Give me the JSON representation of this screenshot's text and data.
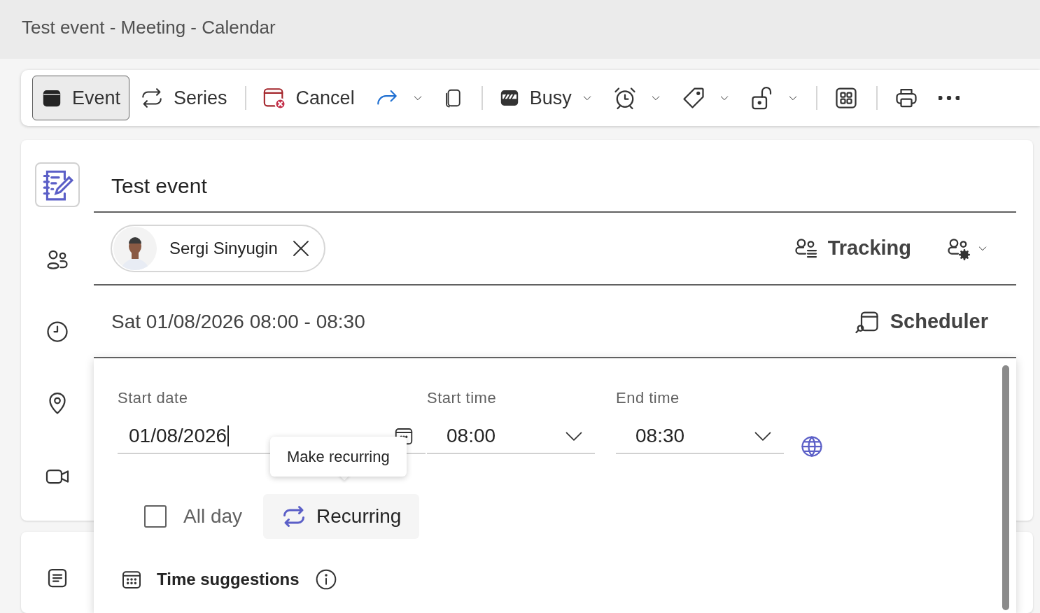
{
  "window": {
    "title": "Test event - Meeting - Calendar"
  },
  "toolbar": [
    {
      "kind": "toggle",
      "label": "Event",
      "selected": true
    },
    {
      "kind": "toggle",
      "label": "Series",
      "selected": false
    },
    {
      "kind": "separator"
    },
    {
      "kind": "button",
      "label": "Cancel"
    },
    {
      "kind": "menu"
    },
    {
      "kind": "icon"
    },
    {
      "kind": "separator"
    },
    {
      "kind": "menu",
      "label": "Busy"
    },
    {
      "kind": "menu"
    },
    {
      "kind": "menu"
    },
    {
      "kind": "menu"
    },
    {
      "kind": "separator"
    },
    {
      "kind": "icon"
    },
    {
      "kind": "separator"
    },
    {
      "kind": "icon"
    },
    {
      "kind": "icon"
    }
  ],
  "event": {
    "title": "Test event",
    "attendees": [
      {
        "name": "Sergi Sinyugin"
      }
    ],
    "tracking": "Tracking",
    "datetime": "Sat 01/08/2026 08:00 - 08:30",
    "scheduler": "Scheduler"
  },
  "date_panel": {
    "start_date": {
      "label": "Start date",
      "value": "01/08/2026"
    },
    "start_time": {
      "label": "Start time",
      "value": "08:00"
    },
    "end_time": {
      "label": "End time",
      "value": "08:30"
    },
    "all_day": {
      "label": "All day",
      "checked": false
    },
    "recurring": {
      "label": "Recurring",
      "tooltip": "Make recurring"
    },
    "time_suggestions": "Time suggestions"
  }
}
